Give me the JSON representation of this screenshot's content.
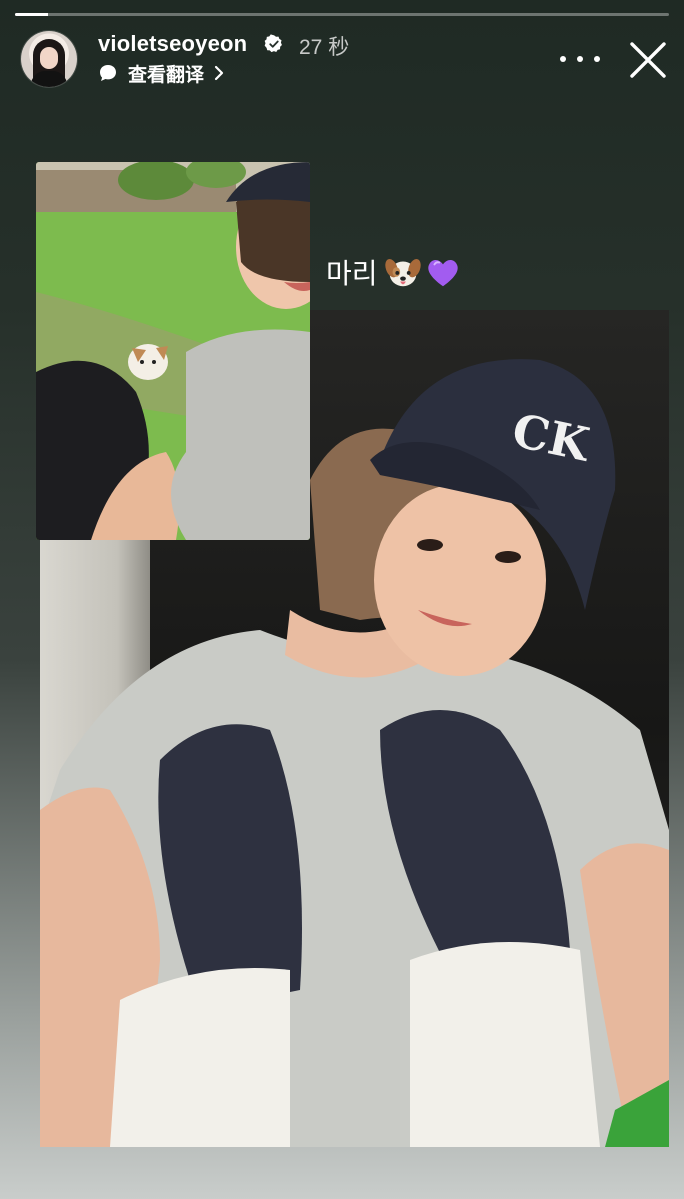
{
  "story": {
    "progress": 0.05,
    "username": "violetseoyeon",
    "verified": true,
    "time_ago": "27 秒",
    "translate_label": "查看翻译"
  },
  "post": {
    "caption_text": "마리",
    "caption_stickers": [
      "dog-face-icon",
      "purple-heart-icon"
    ]
  },
  "colors": {
    "verified_badge": "#ffffff",
    "heart": "#a25cf0",
    "background_top": "#1f2a24",
    "background_bottom": "#c9cdcb"
  }
}
